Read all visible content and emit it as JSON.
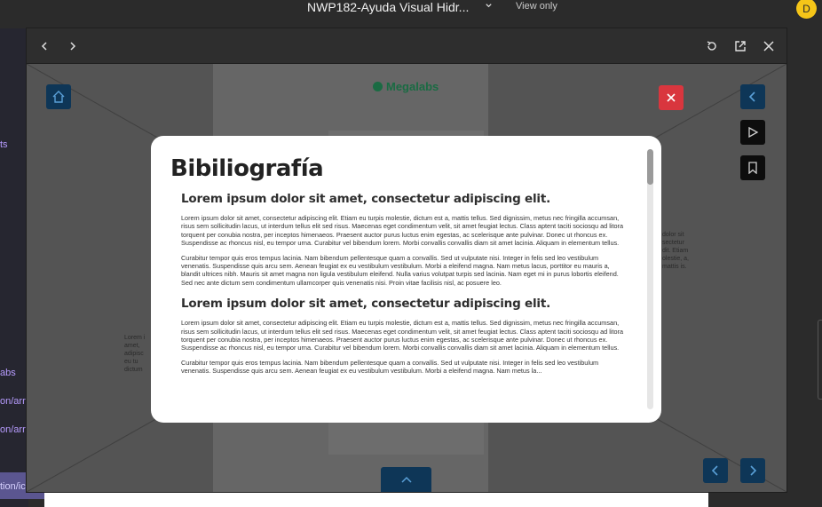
{
  "topbar": {
    "title": "NWP182-Ayuda Visual Hidr...",
    "view_only": "View only",
    "avatar_initial": "D",
    "avatar_color": "#f5c518"
  },
  "sidebar": {
    "items": [
      "ts",
      "abs",
      "on/arr.",
      "on/arr.",
      "tion/ic"
    ]
  },
  "viewer": {
    "icons": [
      "chevron-left-icon",
      "chevron-right-icon",
      "reload-icon",
      "external-link-icon",
      "close-icon"
    ]
  },
  "stage": {
    "brand": "Megalabs",
    "bg_text_left": "Lorem i amet, adipisc eu tu dictum",
    "bg_text_right": "dolor sit sectetur dit. Etiam olestie, a, mattis is.",
    "colors": {
      "nav_button": "#0e3657",
      "close_button": "#d9363e",
      "dark_button": "#0d0d0d"
    }
  },
  "modal": {
    "title": "Bibiliografía",
    "sections": [
      {
        "heading": "Lorem ipsum dolor sit amet, consectetur adipiscing elit.",
        "paragraphs": [
          "Lorem ipsum dolor sit amet, consectetur adipiscing elit. Etiam eu turpis molestie, dictum est a, mattis tellus. Sed dignissim, metus nec fringilla accumsan, risus sem sollicitudin lacus, ut interdum tellus elit sed risus. Maecenas eget condimentum velit, sit amet feugiat lectus. Class aptent taciti sociosqu ad litora torquent per conubia nostra, per inceptos himenaeos. Praesent auctor purus luctus enim egestas, ac scelerisque ante pulvinar. Donec ut rhoncus ex. Suspendisse ac rhoncus nisl, eu tempor urna. Curabitur vel bibendum lorem. Morbi convallis convallis diam sit amet lacinia. Aliquam in elementum tellus.",
          "Curabitur tempor quis eros tempus lacinia. Nam bibendum pellentesque quam a convallis. Sed ut vulputate nisi. Integer in felis sed leo vestibulum venenatis. Suspendisse quis arcu sem. Aenean feugiat ex eu vestibulum vestibulum. Morbi a eleifend magna. Nam metus lacus, porttitor eu mauris a, blandit ultrices nibh. Mauris sit amet magna non ligula vestibulum eleifend. Nulla varius volutpat turpis sed lacinia. Nam eget mi in purus lobortis eleifend. Sed nec ante dictum sem condimentum ullamcorper quis venenatis nisi. Proin vitae facilisis nisl, ac posuere leo."
        ]
      },
      {
        "heading": "Lorem ipsum dolor sit amet, consectetur adipiscing elit.",
        "paragraphs": [
          "Lorem ipsum dolor sit amet, consectetur adipiscing elit. Etiam eu turpis molestie, dictum est a, mattis tellus. Sed dignissim, metus nec fringilla accumsan, risus sem sollicitudin lacus, ut interdum tellus elit sed risus. Maecenas eget condimentum velit, sit amet feugiat lectus. Class aptent taciti sociosqu ad litora torquent per conubia nostra, per inceptos himenaeos. Praesent auctor purus luctus enim egestas, ac scelerisque ante pulvinar. Donec ut rhoncus ex. Suspendisse ac rhoncus nisl, eu tempor urna. Curabitur vel bibendum lorem. Morbi convallis convallis diam sit amet lacinia. Aliquam in elementum tellus.",
          "Curabitur tempor quis eros tempus lacinia. Nam bibendum pellentesque quam a convallis. Sed ut vulputate nisi. Integer in felis sed leo vestibulum venenatis. Suspendisse quis arcu sem. Aenean feugiat ex eu vestibulum vestibulum. Morbi a eleifend magna. Nam metus la..."
        ]
      }
    ]
  }
}
